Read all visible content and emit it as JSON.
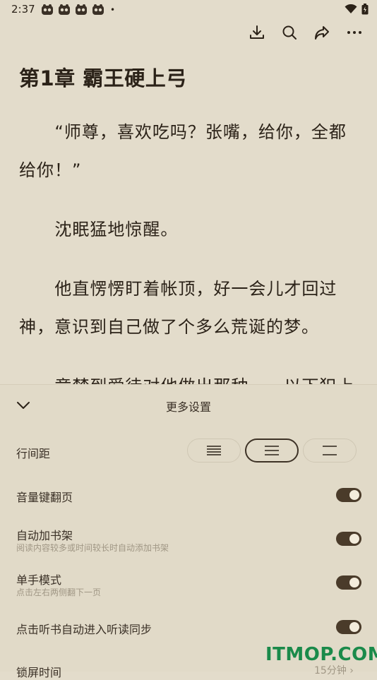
{
  "status_bar": {
    "time": "2:37",
    "notification_icons": [
      "app-icon",
      "app-icon",
      "app-icon",
      "app-icon"
    ],
    "dot": "•"
  },
  "toolbar": {
    "icons": [
      "download-icon",
      "search-icon",
      "share-icon",
      "more-icon"
    ]
  },
  "chapter": {
    "title": "第1章 霸王硬上弓",
    "paragraphs": [
      "“师尊，喜欢吃吗？张嘴，给你，全都给你！”",
      "沈眠猛地惊醒。",
      "他直愣愣盯着帐顶，好一会儿才回过神，意识到自己做了个多么荒诞的梦。",
      "竟梦到爱徒对他做出那种……以下犯上"
    ]
  },
  "settings_panel": {
    "title": "更多设置",
    "line_spacing_label": "行间距",
    "line_spacing_selected": "medium",
    "volume_key_label": "音量键翻页",
    "volume_key_on": true,
    "auto_shelf_label": "自动加书架",
    "auto_shelf_desc": "阅读内容较多或时间较长时自动添加书架",
    "auto_shelf_on": true,
    "one_hand_label": "单手模式",
    "one_hand_desc": "点击左右两侧翻下一页",
    "one_hand_on": true,
    "listen_sync_label": "点击听书自动进入听读同步",
    "listen_sync_on": true,
    "lock_label": "锁屏时间",
    "lock_value": "15分钟 ›"
  },
  "watermark": "ITMOP.COM",
  "colors": {
    "background": "#e3dccb",
    "text": "#2b2218",
    "toggle_on": "#4a3b2a",
    "watermark": "#1a8a4a"
  }
}
